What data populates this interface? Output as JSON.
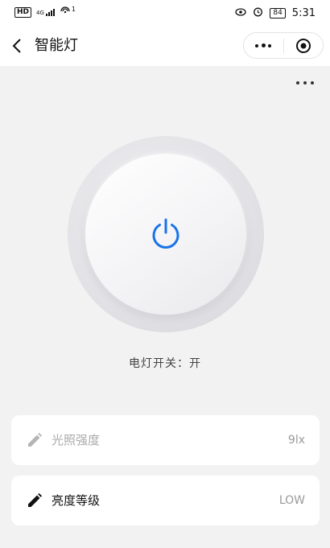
{
  "status_bar": {
    "hd": "HD",
    "network": "4G",
    "hotspot_count": "1",
    "battery": "84",
    "time": "5:31"
  },
  "nav": {
    "title": "智能灯"
  },
  "light": {
    "switch_label": "电灯开关：开",
    "power_state": "on",
    "accent_color": "#1a73e8"
  },
  "cards": [
    {
      "label": "光照强度",
      "value": "9lx",
      "icon": "pencil-icon",
      "enabled": false
    },
    {
      "label": "亮度等级",
      "value": "LOW",
      "icon": "pencil-icon",
      "enabled": true
    }
  ]
}
